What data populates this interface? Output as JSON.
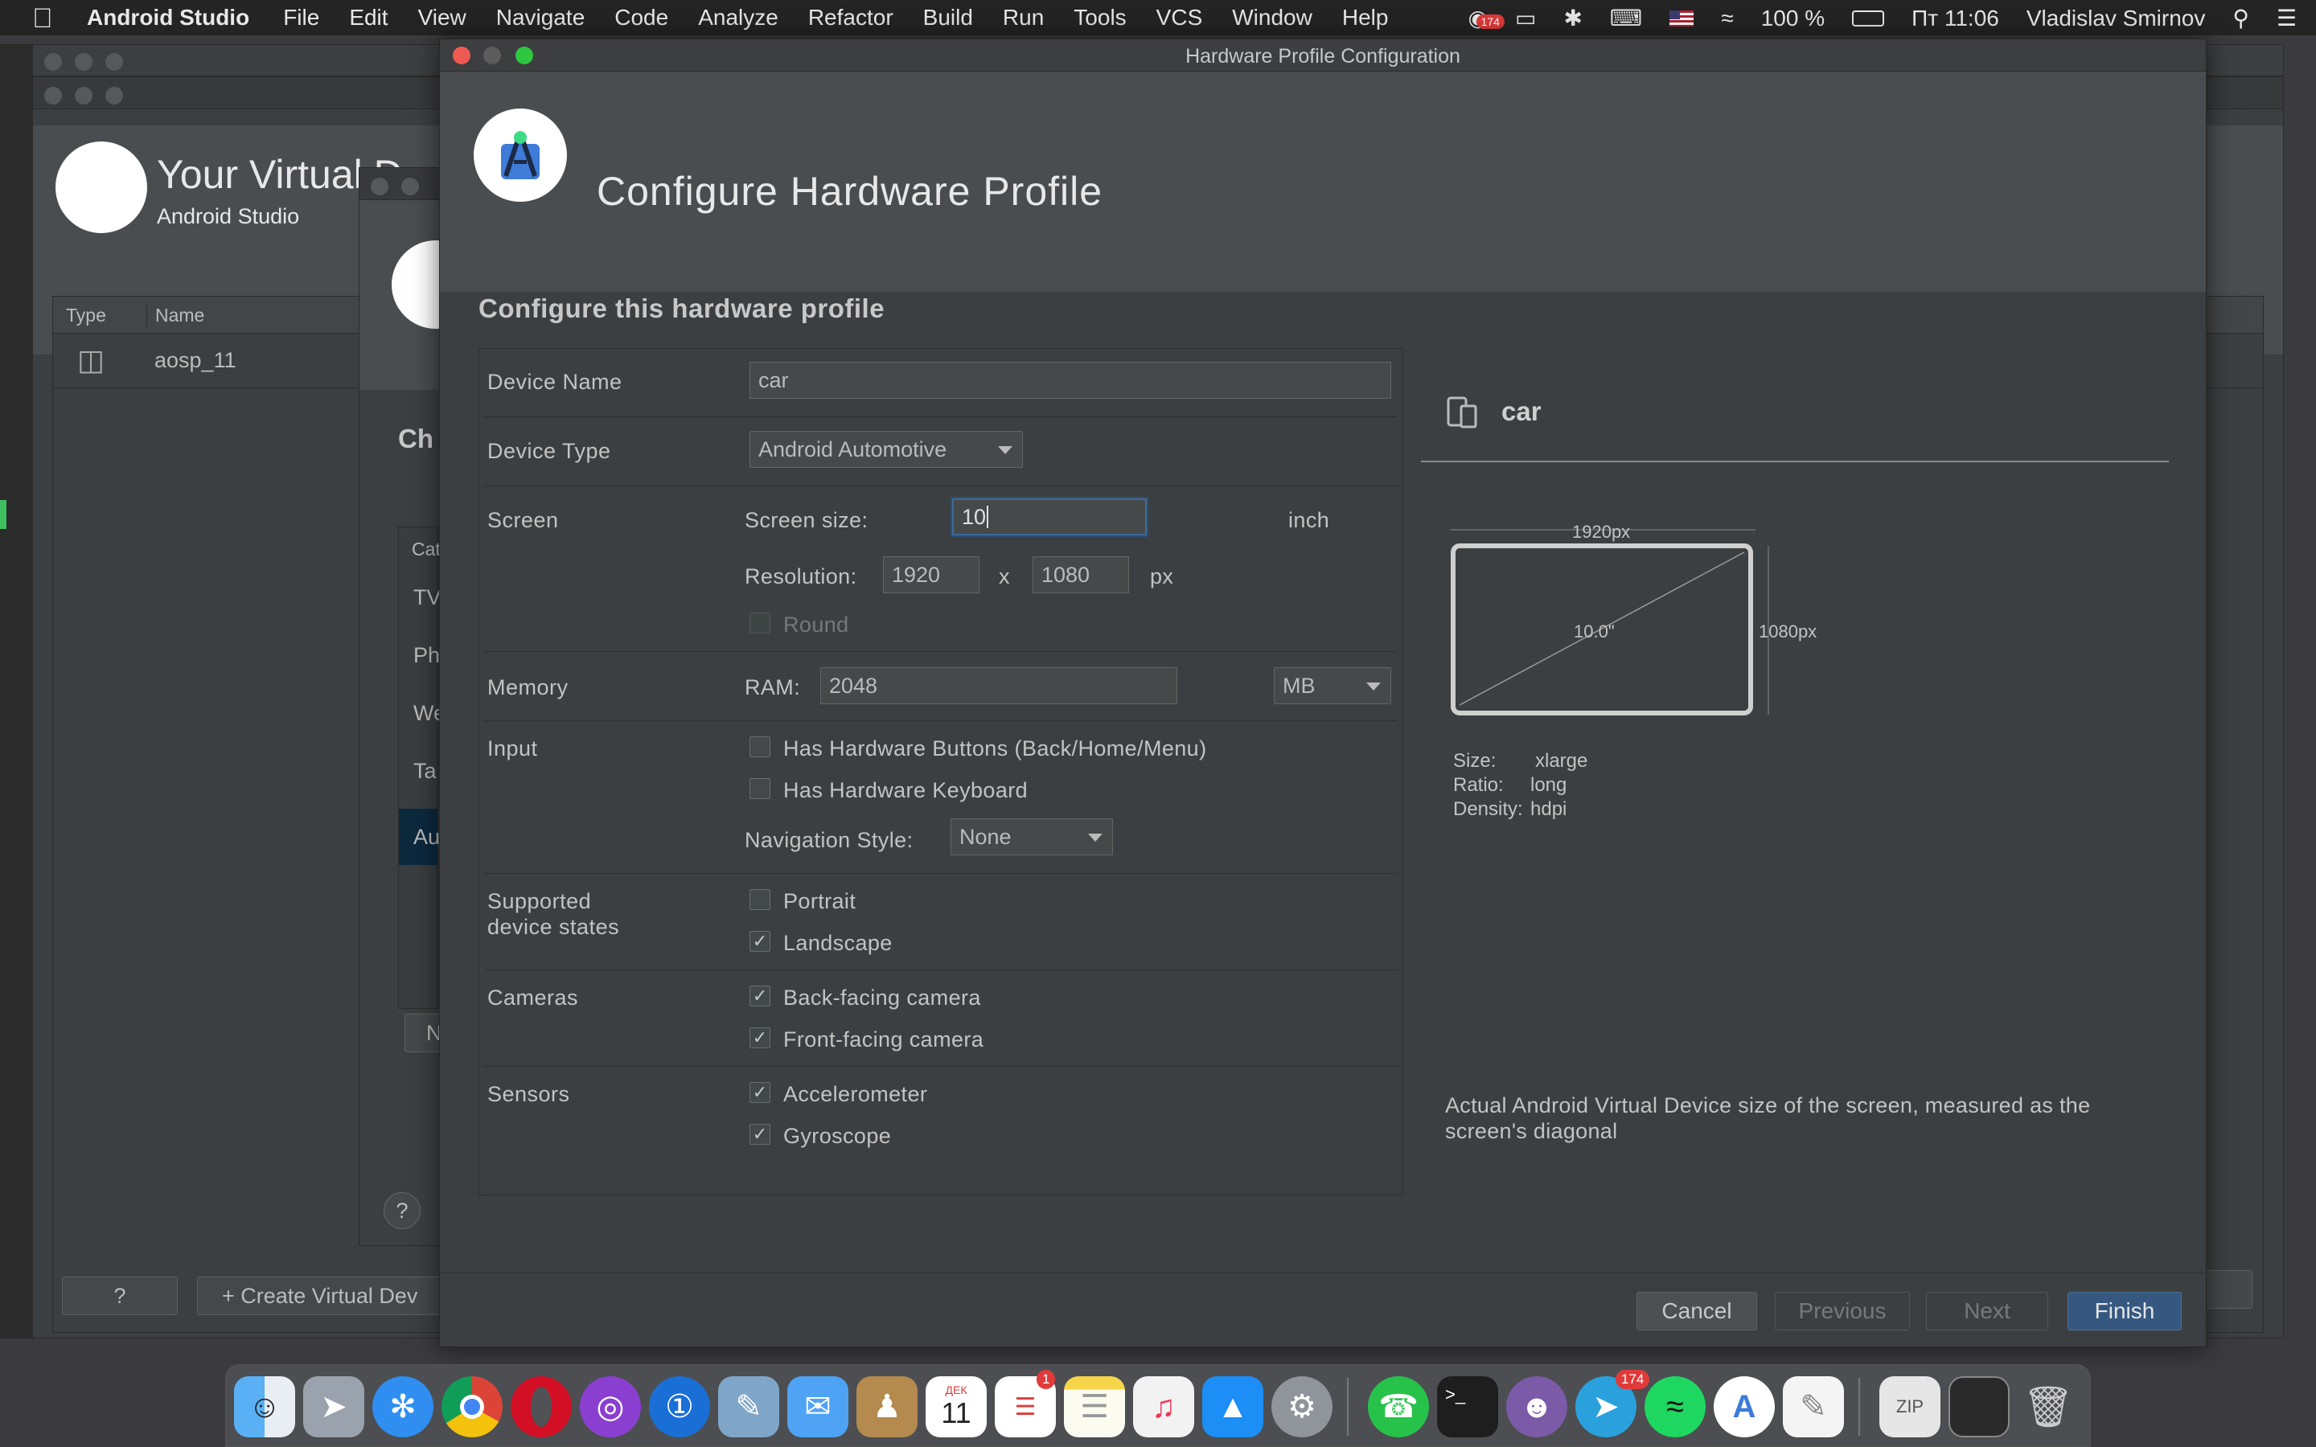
{
  "menubar": {
    "app_name": "Android Studio",
    "menus": [
      "File",
      "Edit",
      "View",
      "Navigate",
      "Code",
      "Analyze",
      "Refactor",
      "Build",
      "Run",
      "Tools",
      "VCS",
      "Window",
      "Help"
    ],
    "notification_count": "174",
    "battery": "100 %",
    "clock": "Пт 11:06",
    "user": "Vladislav Smirnov"
  },
  "avd_manager": {
    "title": "Your Virtual D",
    "subtitle": "Android Studio",
    "columns": [
      "Type",
      "Name"
    ],
    "rows": [
      {
        "name": "aosp_11"
      }
    ],
    "help_label": "?",
    "create_label": "+ Create Virtual Dev"
  },
  "choose_device": {
    "title_fragment": "Ch",
    "categories_header": "Cat",
    "categories": [
      "TV",
      "Ph",
      "We",
      "Ta",
      "Au"
    ],
    "new_button": "N",
    "help_label": "?"
  },
  "dialog": {
    "window_title": "Hardware Profile Configuration",
    "header_title": "Configure Hardware Profile",
    "section_title": "Configure this hardware profile",
    "device_name_label": "Device Name",
    "device_name_value": "car",
    "device_type_label": "Device Type",
    "device_type_value": "Android Automotive",
    "screen_label": "Screen",
    "screen_size_label": "Screen size:",
    "screen_size_value": "10",
    "screen_size_unit": "inch",
    "resolution_label": "Resolution:",
    "resolution_width": "1920",
    "resolution_x": "x",
    "resolution_height": "1080",
    "resolution_unit": "px",
    "round_label": "Round",
    "memory_label": "Memory",
    "ram_label": "RAM:",
    "ram_value": "2048",
    "ram_unit": "MB",
    "input_label": "Input",
    "hw_buttons_label": "Has Hardware Buttons (Back/Home/Menu)",
    "hw_keyboard_label": "Has Hardware Keyboard",
    "nav_style_label": "Navigation Style:",
    "nav_style_value": "None",
    "device_states_label_1": "Supported",
    "device_states_label_2": "device states",
    "portrait_label": "Portrait",
    "landscape_label": "Landscape",
    "cameras_label": "Cameras",
    "back_camera_label": "Back-facing camera",
    "front_camera_label": "Front-facing camera",
    "sensors_label": "Sensors",
    "accelerometer_label": "Accelerometer",
    "gyroscope_label": "Gyroscope",
    "checkbox_states": {
      "round": false,
      "hw_buttons": false,
      "hw_keyboard": false,
      "portrait": false,
      "landscape": true,
      "back_camera": true,
      "front_camera": true,
      "accelerometer": true,
      "gyroscope": true
    },
    "cancel_label": "Cancel",
    "previous_label": "Previous",
    "next_label": "Next",
    "finish_label": "Finish"
  },
  "preview": {
    "device_name": "car",
    "width_label": "1920px",
    "height_label": "1080px",
    "diagonal_label": "10.0\"",
    "size_key": "Size:",
    "size_value": "xlarge",
    "ratio_key": "Ratio:",
    "ratio_value": "long",
    "density_key": "Density:",
    "density_value": "hdpi",
    "description": "Actual Android Virtual Device size of the screen, measured as the screen's diagonal"
  },
  "dock": {
    "apps": [
      "finder",
      "launchpad",
      "safari",
      "chrome",
      "opera",
      "podcasts",
      "1password",
      "preview",
      "messages",
      "contacts",
      "calendar",
      "reminders",
      "notes",
      "music",
      "app-store",
      "system-preferences",
      "whatsapp",
      "terminal",
      "github",
      "telegram",
      "spotify",
      "android-studio",
      "textedit",
      "archive",
      "screenshot",
      "trash"
    ],
    "calendar_month": "ДЕК",
    "calendar_day": "11",
    "reminders_badge": "1",
    "telegram_badge": "174"
  },
  "colors": {
    "accent": "#365880",
    "focus": "#3d6b9a",
    "panel": "#3c3f41",
    "header": "#4a4d50"
  }
}
